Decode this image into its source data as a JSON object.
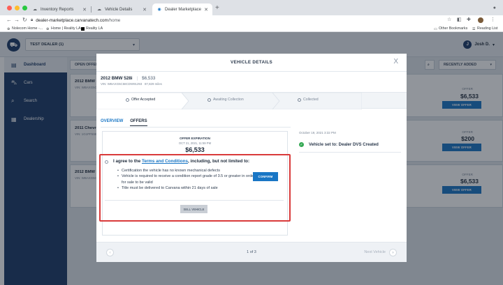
{
  "browser": {
    "tabs": [
      {
        "label": "Inventory Reports",
        "icon": "cloud-icon"
      },
      {
        "label": "Vehicle Details",
        "icon": "cloud-icon"
      },
      {
        "label": "Dealer Marketplace",
        "icon": "carvana-icon",
        "active": true
      }
    ],
    "url_host": "dealer-marketplace.carvanatech.com",
    "url_path": "/home",
    "bookmarks": [
      {
        "label": "Nolecom Home -..."
      },
      {
        "label": "Home | Reality LA"
      },
      {
        "label": "Reality LA"
      }
    ],
    "other_bookmarks": "Other Bookmarks",
    "reading_list": "Reading List",
    "traffic_colors": [
      "#ff5f57",
      "#febc2e",
      "#28c840"
    ]
  },
  "app": {
    "dealer_select": "TEST DEALER (1)",
    "user_name": "Josh D.",
    "user_initial": "J",
    "sidebar": [
      {
        "label": "Dashboard",
        "icon": "dashboard-icon",
        "active": true
      },
      {
        "label": "Cars",
        "icon": "car-icon"
      },
      {
        "label": "Search",
        "icon": "search-icon"
      },
      {
        "label": "Dealership",
        "icon": "store-icon"
      }
    ],
    "open_offers": "OPEN OFFERS",
    "recently_added": "RECENTLY ADDED",
    "cards": [
      {
        "title": "2012 BMW 5",
        "vin": "VIN: WBAXG5C",
        "offer_label": "OFFER",
        "offer": "$6,533",
        "button": "VIEW OFFER"
      },
      {
        "title": "2011 Chevrol",
        "vin": "VIN: 1G1PF5SB",
        "offer_label": "OFFER",
        "offer": "$200",
        "button": "VIEW OFFER"
      },
      {
        "title": "2012 BMW 5",
        "vin": "VIN: WBAXG5C",
        "offer_label": "OFFER",
        "offer": "$6,533",
        "button": "VIEW OFFER"
      }
    ],
    "accent": "#1976c5",
    "sidebar_color": "#1c3a66"
  },
  "modal": {
    "title": "VEHICLE DETAILS",
    "close": "X",
    "vehicle_title": "2012 BMW 528i",
    "vehicle_price": "$6,533",
    "vin": "VIN: WBAXG5C58CDW91293",
    "miles": "87,829 miles",
    "steps": [
      "Offer Accepted",
      "Awaiting Collection",
      "Collected"
    ],
    "tabs": [
      "OVERVIEW",
      "OFFERS"
    ],
    "offer_expiration_label": "OFFER EXPIRATION",
    "offer_expiration_date": "OCT 21, 2021, 11:59 PM",
    "offer_value": "$6,533",
    "agree_prefix": "I agree to the ",
    "agree_link": "Terms and Conditions",
    "agree_suffix": ", including, but not limited to:",
    "conditions": [
      "Certification the vehicle has no known mechanical defects",
      "Vehicle is required to receive a condition report grade of 3.5 or greater in order for sale to be valid",
      "Title must be delivered to Carvana within 21 days of sale"
    ],
    "confirm": "CONFIRM",
    "sell_vehicle": "SELL VEHICLE",
    "timeline_date": "October 19, 2021 3:32 PM",
    "timeline_text": "Vehicle set to: Dealer DVS Created",
    "pager": "1 of 3",
    "next_vehicle": "Next Vehicle",
    "highlight_color": "#d93a3a"
  }
}
